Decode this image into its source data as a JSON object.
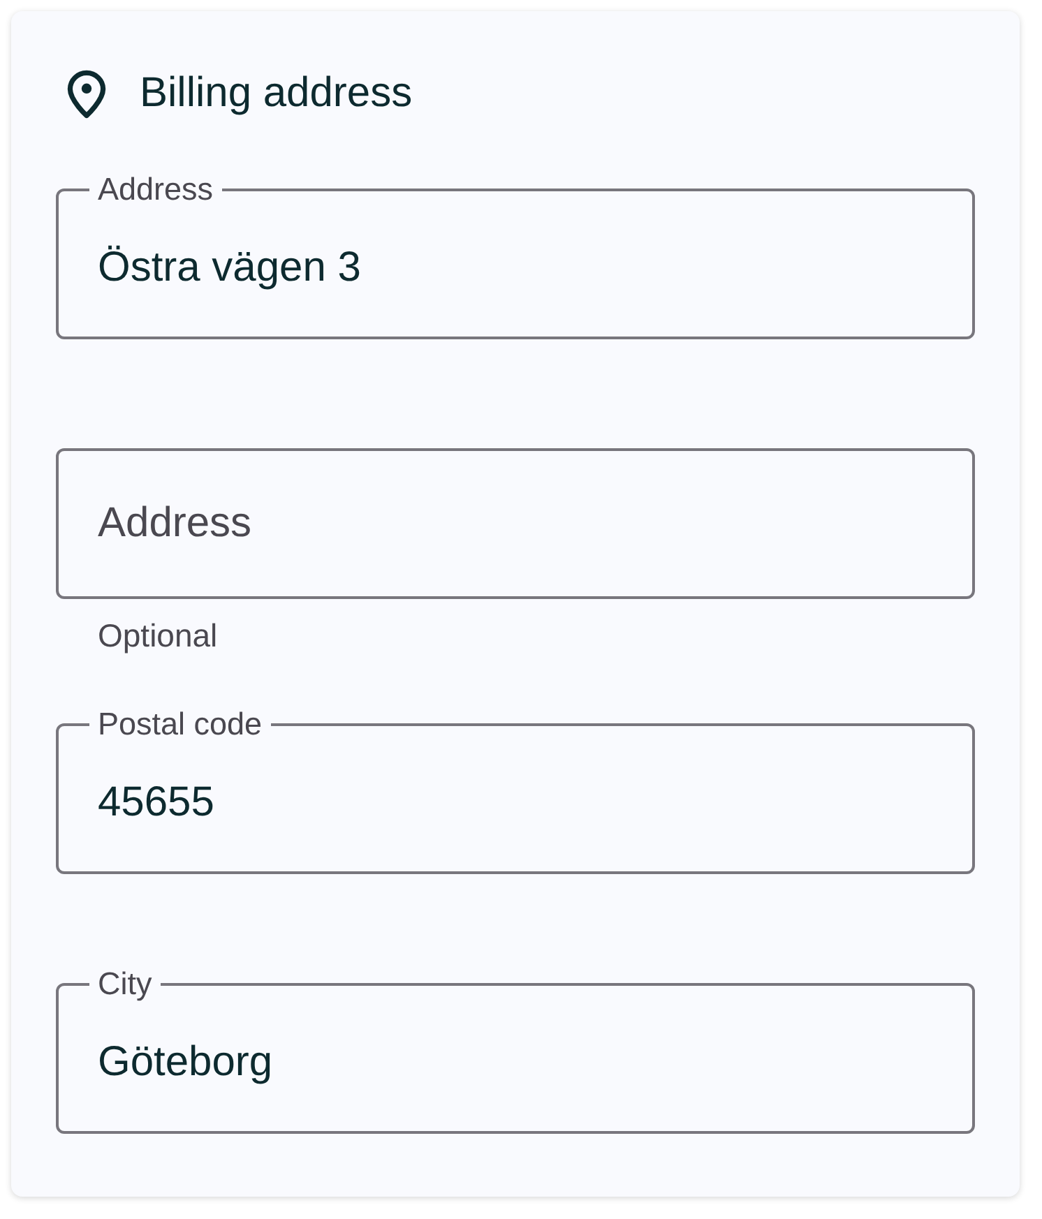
{
  "section": {
    "title": "Billing address"
  },
  "fields": [
    {
      "label": "Address",
      "value": "Östra vägen 3"
    },
    {
      "placeholder": "Address",
      "helper": "Optional"
    },
    {
      "label": "Postal code",
      "value": "45655"
    },
    {
      "label": "City",
      "value": "Göteborg"
    }
  ]
}
